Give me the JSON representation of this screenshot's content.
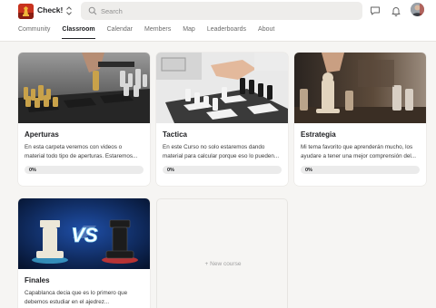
{
  "header": {
    "app_name": "Check!",
    "search_placeholder": "Search",
    "icons": [
      "logo-icon",
      "switch-icon",
      "search-icon",
      "chat-icon",
      "bell-icon",
      "avatar"
    ]
  },
  "nav": {
    "tabs": [
      {
        "label": "Community"
      },
      {
        "label": "Classroom",
        "active": true
      },
      {
        "label": "Calendar"
      },
      {
        "label": "Members"
      },
      {
        "label": "Map"
      },
      {
        "label": "Leaderboards"
      },
      {
        "label": "About"
      }
    ]
  },
  "courses": [
    {
      "title": "Aperturas",
      "desc_line1": "En esta carpeta veremos con videos o",
      "desc_line2": "material todo tipo de aperturas. Estaremos...",
      "progress_label": "0%",
      "progress": 0
    },
    {
      "title": "Tactica",
      "desc_line1": "En este Curso no solo estaremos dando",
      "desc_line2": "material para calcular porque eso lo pueden...",
      "progress_label": "0%",
      "progress": 0
    },
    {
      "title": "Estrategia",
      "desc_line1": "Mi tema favorito que aprenderán mucho, los",
      "desc_line2": "ayudare a tener una mejor comprensión del...",
      "progress_label": "0%",
      "progress": 0
    },
    {
      "title": "Finales",
      "desc_line1": "Capablanca decia que es lo primero que",
      "desc_line2": "debemos estudiar en el ajedrez...",
      "image_text": "VS"
    }
  ],
  "new_course_label": "+ New course",
  "colors": {
    "page_background": "#f6f5f3",
    "brand_logo": "#c8321e",
    "active_tab": "#202124"
  }
}
